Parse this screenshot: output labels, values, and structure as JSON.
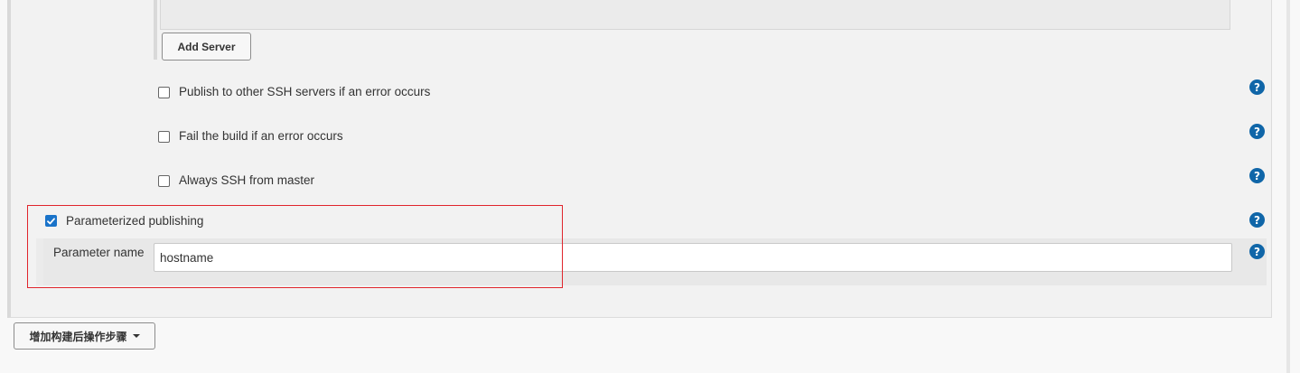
{
  "server_section": {
    "add_server_label": "Add Server"
  },
  "options": {
    "publish_other_ssh": {
      "label": "Publish to other SSH servers if an error occurs",
      "checked": false
    },
    "fail_build": {
      "label": "Fail the build if an error occurs",
      "checked": false
    },
    "always_ssh_master": {
      "label": "Always SSH from master",
      "checked": false
    }
  },
  "parameterized": {
    "label": "Parameterized publishing",
    "checked": true,
    "parameter_name_label": "Parameter name",
    "parameter_name_value": "hostname"
  },
  "help_icon_text": "?",
  "footer": {
    "add_post_build_step_label": "增加构建后操作步骤"
  },
  "colors": {
    "checkbox_accent": "#1a73c9",
    "help_icon": "#1066a8",
    "highlight_border": "#e0252c"
  }
}
